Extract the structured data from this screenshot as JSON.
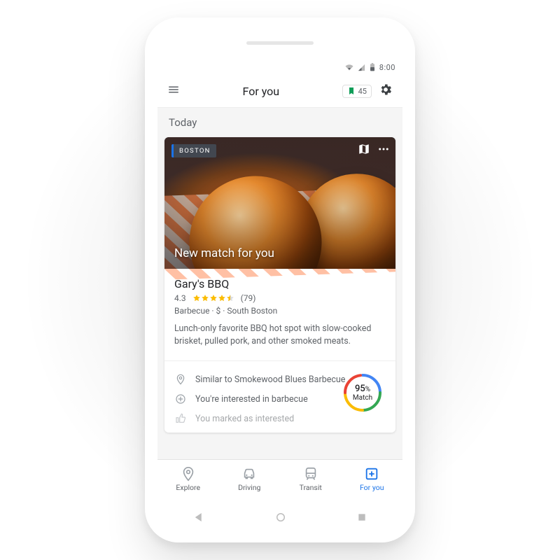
{
  "status": {
    "time": "8:00"
  },
  "appbar": {
    "title": "For you",
    "saved_count": "45"
  },
  "section": {
    "today": "Today"
  },
  "card": {
    "location_chip": "BOSTON",
    "hero_caption": "New match for you",
    "place_name": "Gary's BBQ",
    "rating_value": "4.3",
    "rating_count": "(79)",
    "category": "Barbecue",
    "price": "$",
    "area": "South Boston",
    "meta_sep": " · ",
    "description": "Lunch-only favorite BBQ hot spot with slow-cooked brisket, pulled pork, and other smoked meats.",
    "reasons": [
      "Similar to Smokewood Blues Barbecue",
      "You're interested in barbecue",
      "You marked as interested"
    ],
    "match_percent": "95",
    "match_suffix": "%",
    "match_label": "Match"
  },
  "nav": {
    "explore": "Explore",
    "driving": "Driving",
    "transit": "Transit",
    "for_you": "For you"
  },
  "colors": {
    "accent": "#1a73e8",
    "star": "#fbbc04",
    "ring_blue": "#4285F4",
    "ring_red": "#EA4335",
    "ring_yellow": "#FBBC05",
    "ring_green": "#34A853"
  }
}
